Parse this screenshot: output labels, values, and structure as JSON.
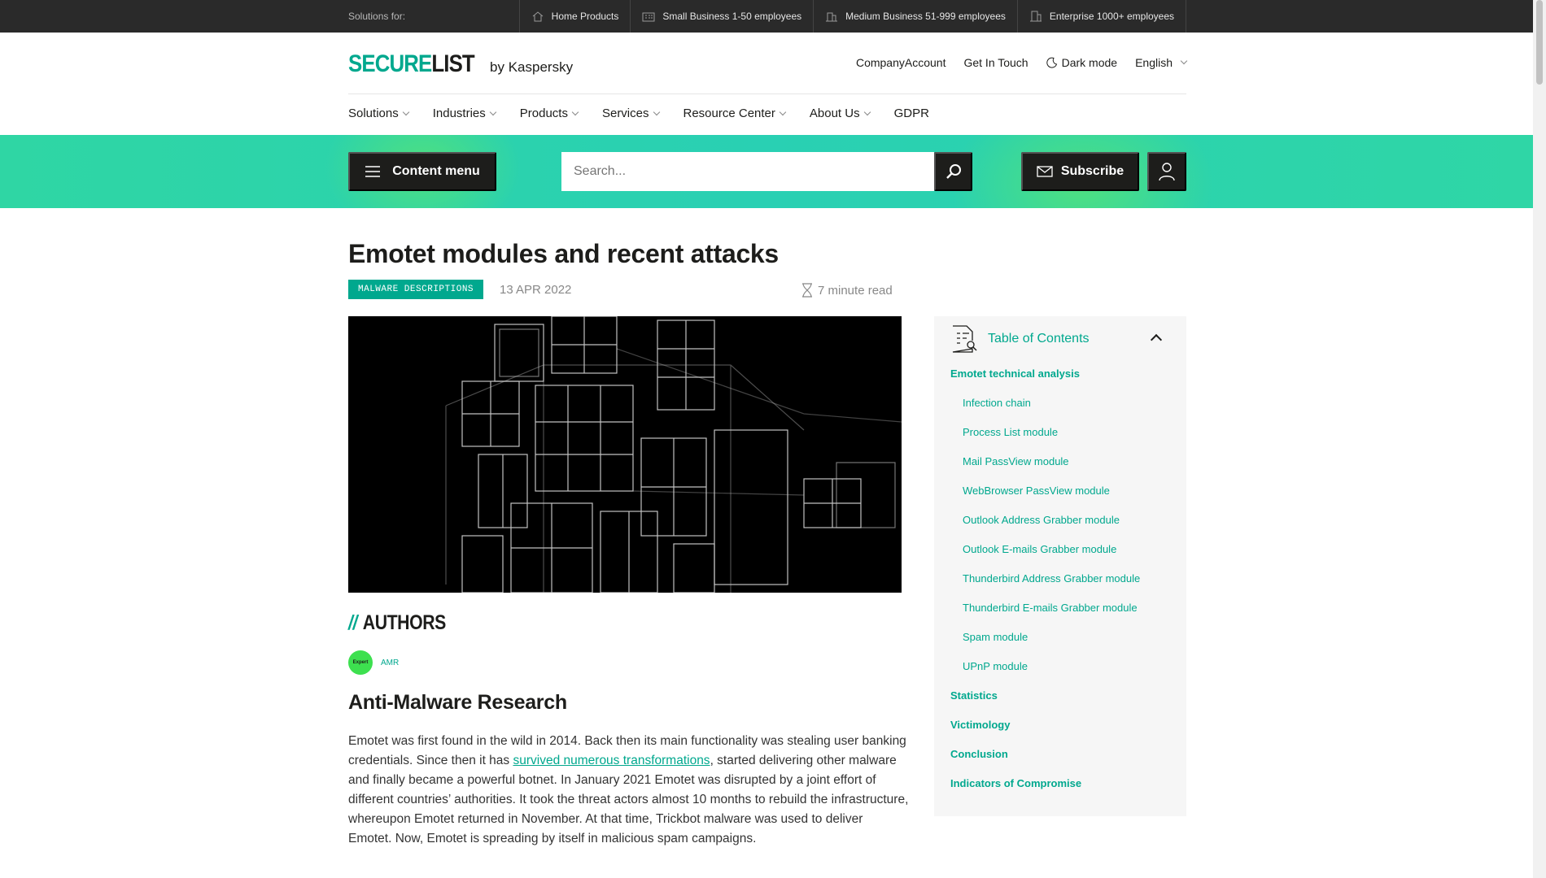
{
  "topbar": {
    "label": "Solutions for:",
    "segments": [
      {
        "label": "Home Products",
        "icon": "house-icon"
      },
      {
        "label": "Small Business 1-50 employees",
        "icon": "small-office-icon"
      },
      {
        "label": "Medium Business 51-999 employees",
        "icon": "building-icon"
      },
      {
        "label": "Enterprise 1000+ employees",
        "icon": "tower-icon"
      }
    ]
  },
  "header": {
    "logo_a": "SECURE",
    "logo_b": "LIST",
    "logo_by": "by Kaspersky",
    "links": {
      "company_account": "CompanyAccount",
      "get_in_touch": "Get In Touch",
      "dark_mode": "Dark mode",
      "language": "English"
    }
  },
  "nav": {
    "items": [
      {
        "label": "Solutions",
        "dropdown": true
      },
      {
        "label": "Industries",
        "dropdown": true
      },
      {
        "label": "Products",
        "dropdown": true
      },
      {
        "label": "Services",
        "dropdown": true
      },
      {
        "label": "Resource Center",
        "dropdown": true
      },
      {
        "label": "About Us",
        "dropdown": true
      },
      {
        "label": "GDPR",
        "dropdown": false
      }
    ]
  },
  "band": {
    "content_menu": "Content menu",
    "search_placeholder": "Search...",
    "subscribe": "Subscribe"
  },
  "article": {
    "title": "Emotet modules and recent attacks",
    "tag": "MALWARE DESCRIPTIONS",
    "date": "13 APR 2022",
    "read_time": "7 minute read",
    "authors_heading": "AUTHORS",
    "authors_slashes": "//",
    "author_badge": "Expert",
    "author_name": "AMR",
    "author_full": "Anti-Malware Research",
    "body_1": "Emotet was first found in the wild in 2014. Back then its main functionality was stealing user banking credentials. Since then it has ",
    "body_link": "survived numerous transformations",
    "body_2": ", started delivering other malware and finally became a powerful botnet. In January 2021 Emotet was disrupted by a joint effort of different countries’ authorities. It took the threat actors almost 10 months to rebuild the infrastructure, whereupon Emotet returned in November. At that time, Trickbot malware was used to deliver Emotet. Now, Emotet is spreading by itself in malicious spam campaigns."
  },
  "toc": {
    "title": "Table of Contents",
    "items": [
      {
        "label": "Emotet technical analysis",
        "level": "main"
      },
      {
        "label": "Infection chain",
        "level": "sub"
      },
      {
        "label": "Process List module",
        "level": "sub"
      },
      {
        "label": "Mail PassView module",
        "level": "sub"
      },
      {
        "label": "WebBrowser PassView module",
        "level": "sub"
      },
      {
        "label": "Outlook Address Grabber module",
        "level": "sub"
      },
      {
        "label": "Outlook E-mails Grabber module",
        "level": "sub"
      },
      {
        "label": "Thunderbird Address Grabber module",
        "level": "sub"
      },
      {
        "label": "Thunderbird E-mails Grabber module",
        "level": "sub"
      },
      {
        "label": "Spam module",
        "level": "sub"
      },
      {
        "label": "UPnP module",
        "level": "sub"
      },
      {
        "label": "Statistics",
        "level": "main"
      },
      {
        "label": "Victimology",
        "level": "main"
      },
      {
        "label": "Conclusion",
        "level": "main"
      },
      {
        "label": "Indicators of Compromise",
        "level": "main"
      }
    ]
  },
  "colors": {
    "accent": "#00a88e",
    "band": "#29d0b3",
    "dark": "#1d1d1b"
  }
}
